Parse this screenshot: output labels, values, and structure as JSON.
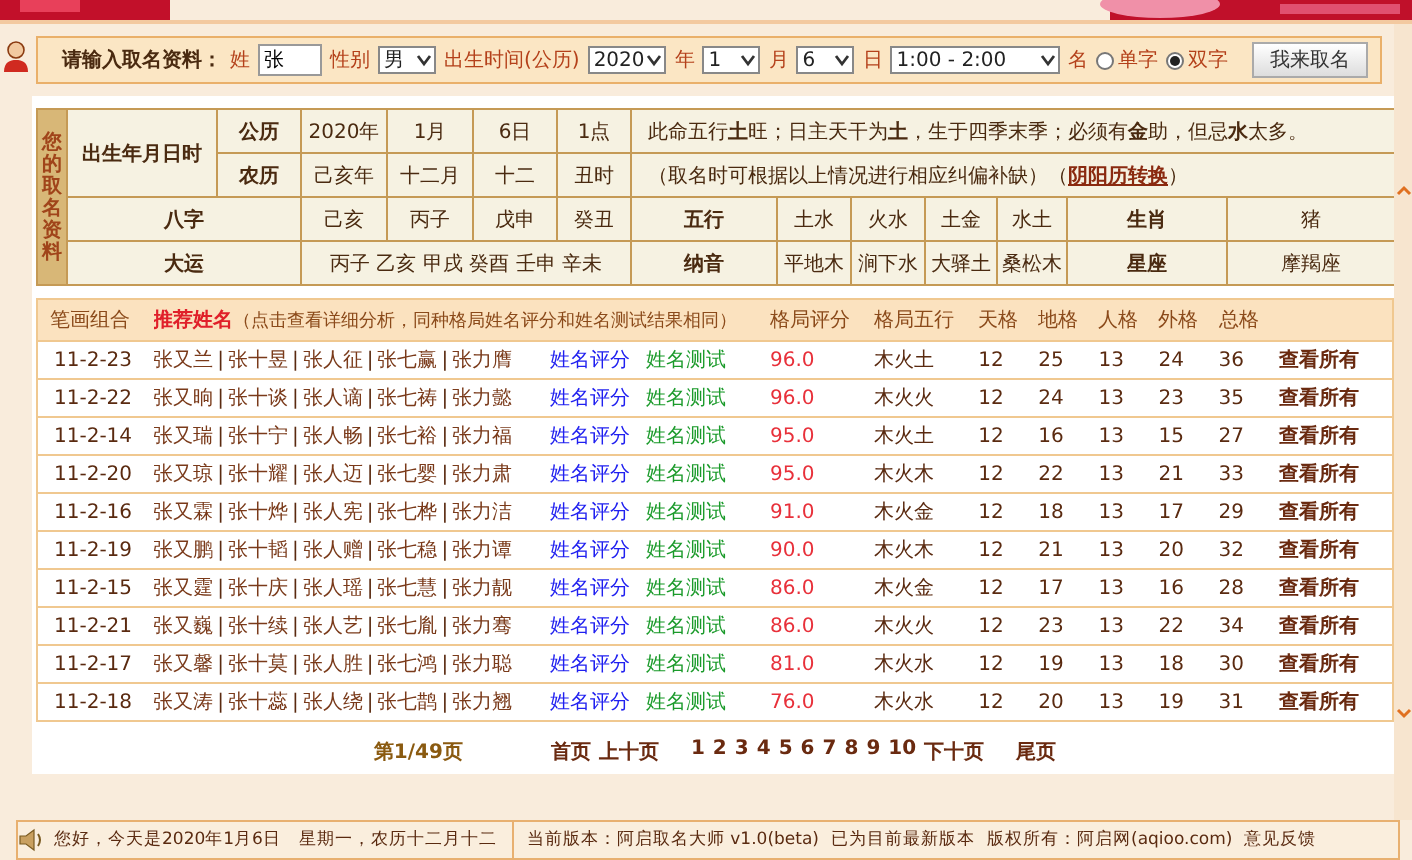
{
  "form": {
    "prompt": "请输入取名资料：",
    "surname_label": "姓",
    "surname": "张",
    "gender_label": "性别",
    "gender": "男",
    "birth_label": "出生时间(公历)",
    "year": "2020",
    "year_unit": "年",
    "month": "1",
    "month_unit": "月",
    "day": "6",
    "day_unit": "日",
    "hour": "1:00 - 2:00",
    "name_label": "名",
    "options": [
      {
        "label": "单字",
        "selected": false
      },
      {
        "label": "双字",
        "selected": true
      }
    ],
    "button": "我来取名"
  },
  "info": {
    "side_title": "您的取名资料",
    "birth_title": "出生年月日时",
    "solar": {
      "label": "公历",
      "year": "2020年",
      "month": "1月",
      "day": "6日",
      "hour": "1点",
      "text": "此命五行**土**旺；日主天干为**土**，生于四季末季；必须有**金**助，但忌**水**太多。"
    },
    "lunar": {
      "label": "农历",
      "year": "己亥年",
      "month": "十二月",
      "day": "十二",
      "hour": "丑时",
      "note_before": "（取名时可根据以上情况进行相应纠偏补缺）（",
      "note_link": "阴阳历转换",
      "note_after": "）"
    },
    "bazi": {
      "label": "八字",
      "values": [
        "己亥",
        "丙子",
        "戊申",
        "癸丑"
      ],
      "wuxing_label": "五行",
      "wuxing": [
        "土水",
        "火水",
        "土金",
        "水土"
      ],
      "zodiac_label": "生肖",
      "zodiac": "猪"
    },
    "dayun": {
      "label": "大运",
      "values": [
        "丙子",
        "乙亥",
        "甲戌",
        "癸酉",
        "壬申",
        "辛未"
      ],
      "nayin_label": "纳音",
      "nayin": [
        "平地木",
        "涧下水",
        "大驿土",
        "桑松木"
      ],
      "star_label": "星座",
      "star": "摩羯座"
    }
  },
  "results": {
    "separator": "|",
    "columns": {
      "strokes": "笔画组合",
      "names": "推荐姓名",
      "names_hint": "（点击查看详细分析，同种格局姓名评分和姓名测试结果相同）",
      "score": "格局评分",
      "wuxing": "格局五行",
      "tian": "天格",
      "di": "地格",
      "ren": "人格",
      "wai": "外格",
      "zong": "总格"
    },
    "rows": [
      {
        "strokes": "11-2-23",
        "names": [
          "张又兰",
          "张十昱",
          "张人征",
          "张七赢",
          "张力膺"
        ],
        "rate": "姓名评分",
        "test": "姓名测试",
        "score": "96.0",
        "wuxing": "木火土",
        "tian": "12",
        "di": "25",
        "ren": "13",
        "wai": "24",
        "zong": "36",
        "more": "查看所有"
      },
      {
        "strokes": "11-2-22",
        "names": [
          "张又晌",
          "张十谈",
          "张人谪",
          "张七祷",
          "张力懿"
        ],
        "rate": "姓名评分",
        "test": "姓名测试",
        "score": "96.0",
        "wuxing": "木火火",
        "tian": "12",
        "di": "24",
        "ren": "13",
        "wai": "23",
        "zong": "35",
        "more": "查看所有"
      },
      {
        "strokes": "11-2-14",
        "names": [
          "张又瑞",
          "张十宁",
          "张人畅",
          "张七裕",
          "张力福"
        ],
        "rate": "姓名评分",
        "test": "姓名测试",
        "score": "95.0",
        "wuxing": "木火土",
        "tian": "12",
        "di": "16",
        "ren": "13",
        "wai": "15",
        "zong": "27",
        "more": "查看所有"
      },
      {
        "strokes": "11-2-20",
        "names": [
          "张又琼",
          "张十耀",
          "张人迈",
          "张七婴",
          "张力肃"
        ],
        "rate": "姓名评分",
        "test": "姓名测试",
        "score": "95.0",
        "wuxing": "木火木",
        "tian": "12",
        "di": "22",
        "ren": "13",
        "wai": "21",
        "zong": "33",
        "more": "查看所有"
      },
      {
        "strokes": "11-2-16",
        "names": [
          "张又霖",
          "张十烨",
          "张人宪",
          "张七桦",
          "张力洁"
        ],
        "rate": "姓名评分",
        "test": "姓名测试",
        "score": "91.0",
        "wuxing": "木火金",
        "tian": "12",
        "di": "18",
        "ren": "13",
        "wai": "17",
        "zong": "29",
        "more": "查看所有"
      },
      {
        "strokes": "11-2-19",
        "names": [
          "张又鹏",
          "张十韬",
          "张人赠",
          "张七稳",
          "张力谭"
        ],
        "rate": "姓名评分",
        "test": "姓名测试",
        "score": "90.0",
        "wuxing": "木火木",
        "tian": "12",
        "di": "21",
        "ren": "13",
        "wai": "20",
        "zong": "32",
        "more": "查看所有"
      },
      {
        "strokes": "11-2-15",
        "names": [
          "张又霆",
          "张十庆",
          "张人瑶",
          "张七慧",
          "张力靓"
        ],
        "rate": "姓名评分",
        "test": "姓名测试",
        "score": "86.0",
        "wuxing": "木火金",
        "tian": "12",
        "di": "17",
        "ren": "13",
        "wai": "16",
        "zong": "28",
        "more": "查看所有"
      },
      {
        "strokes": "11-2-21",
        "names": [
          "张又巍",
          "张十续",
          "张人艺",
          "张七胤",
          "张力骞"
        ],
        "rate": "姓名评分",
        "test": "姓名测试",
        "score": "86.0",
        "wuxing": "木火火",
        "tian": "12",
        "di": "23",
        "ren": "13",
        "wai": "22",
        "zong": "34",
        "more": "查看所有"
      },
      {
        "strokes": "11-2-17",
        "names": [
          "张又馨",
          "张十莫",
          "张人胜",
          "张七鸿",
          "张力聪"
        ],
        "rate": "姓名评分",
        "test": "姓名测试",
        "score": "81.0",
        "wuxing": "木火水",
        "tian": "12",
        "di": "19",
        "ren": "13",
        "wai": "18",
        "zong": "30",
        "more": "查看所有"
      },
      {
        "strokes": "11-2-18",
        "names": [
          "张又涛",
          "张十蕊",
          "张人绕",
          "张七鹊",
          "张力翘"
        ],
        "rate": "姓名评分",
        "test": "姓名测试",
        "score": "76.0",
        "wuxing": "木火水",
        "tian": "12",
        "di": "20",
        "ren": "13",
        "wai": "19",
        "zong": "31",
        "more": "查看所有"
      }
    ]
  },
  "pagination": {
    "status": "第1/49页",
    "first": "首页",
    "prev": "上十页",
    "pages": [
      "1",
      "2",
      "3",
      "4",
      "5",
      "6",
      "7",
      "8",
      "9",
      "10"
    ],
    "next": "下十页",
    "last": "尾页"
  },
  "status_bar": {
    "greeting": "您好，今天是2020年1月6日　星期一，农历十二月十二",
    "version": "当前版本：阿启取名大师 v1.0(beta)",
    "update": "已为目前最新版本",
    "copyright": "版权所有：阿启网(aqioo.com)",
    "feedback": "意见反馈"
  }
}
